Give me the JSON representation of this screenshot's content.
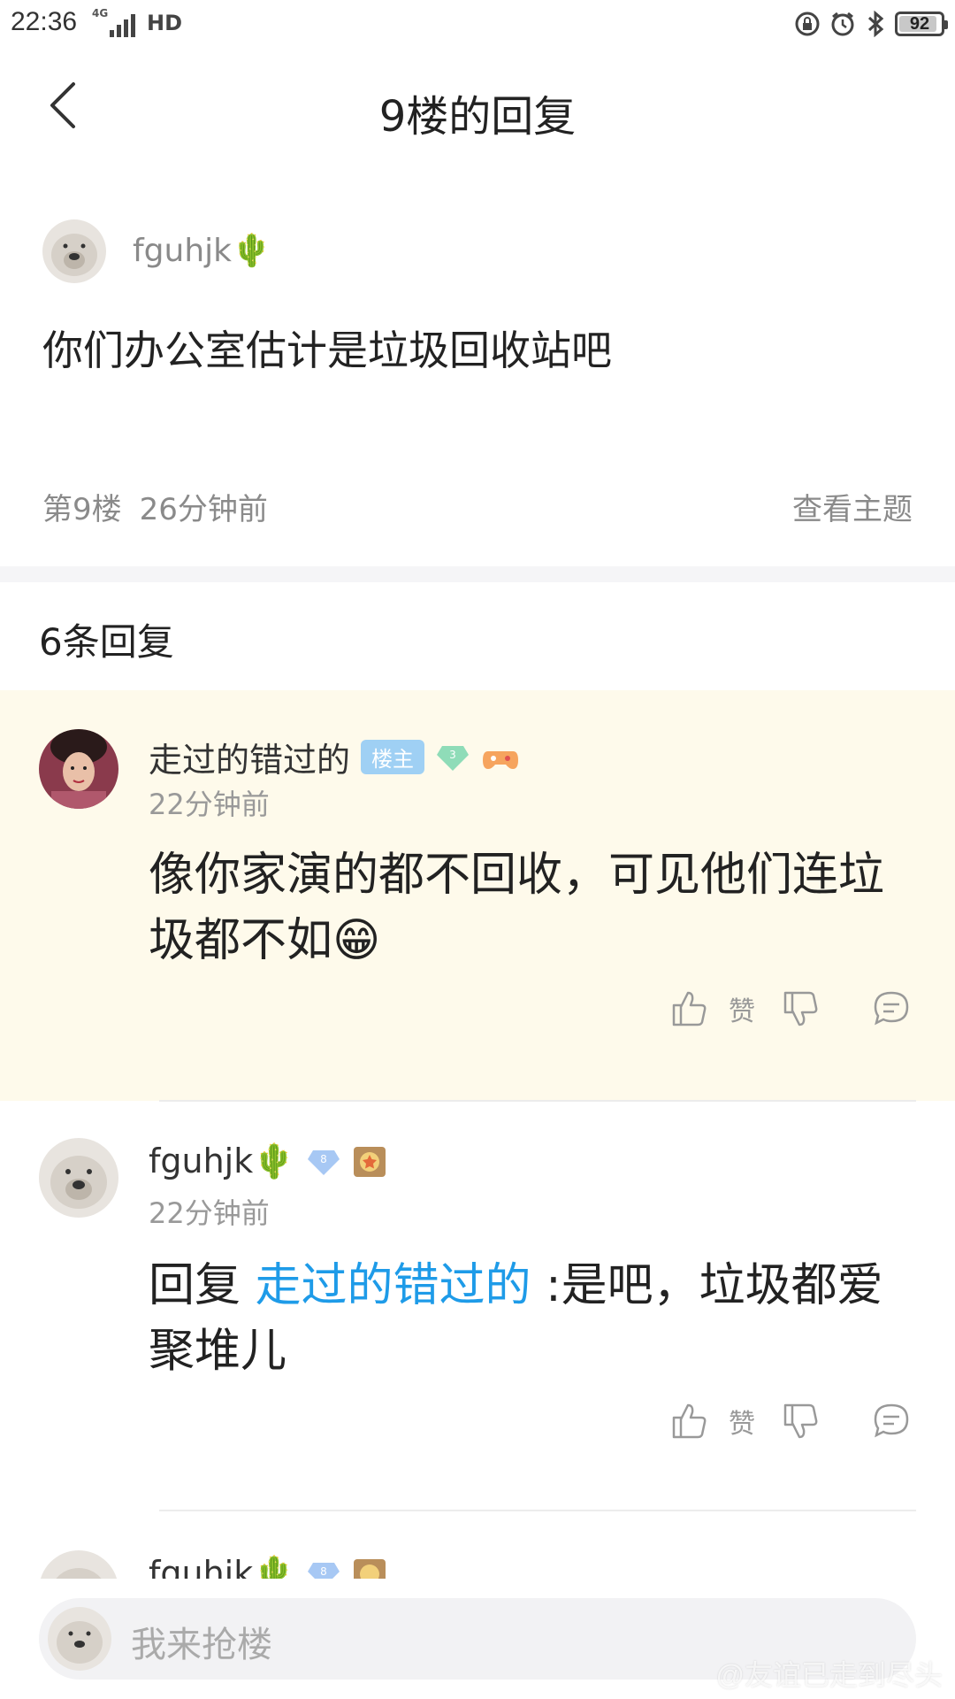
{
  "status_bar": {
    "time": "22:36",
    "network": "4G",
    "hd": "HD",
    "battery": "92",
    "battery_level": 0.92
  },
  "header": {
    "title": "9楼的回复"
  },
  "post": {
    "username": "fguhjk🌵",
    "content": "你们办公室估计是垃圾回收站吧",
    "floor": "第9楼",
    "time": "26分钟前",
    "view_topic": "查看主题"
  },
  "reply_count": "6条回复",
  "replies": [
    {
      "username": "走过的错过的",
      "owner_badge": "楼主",
      "level": "3",
      "time": "22分钟前",
      "text": "像你家演的都不回收，可见他们连垃圾都不如😁",
      "like_label": "赞"
    },
    {
      "username": "fguhjk🌵",
      "level": "8",
      "time": "22分钟前",
      "reply_prefix": "回复 ",
      "mention": "走过的错过的",
      "text": " :是吧，垃圾都爱聚堆儿",
      "like_label": "赞"
    },
    {
      "username": "fguhjk🌵",
      "level": "8"
    }
  ],
  "bottom_bar": {
    "placeholder": "我来抢楼",
    "watermark": "@友谊已走到尽头"
  },
  "colors": {
    "highlight_bg": "#fefaeb",
    "mention": "#1e9be8",
    "owner_badge": "#9fd0f4"
  }
}
